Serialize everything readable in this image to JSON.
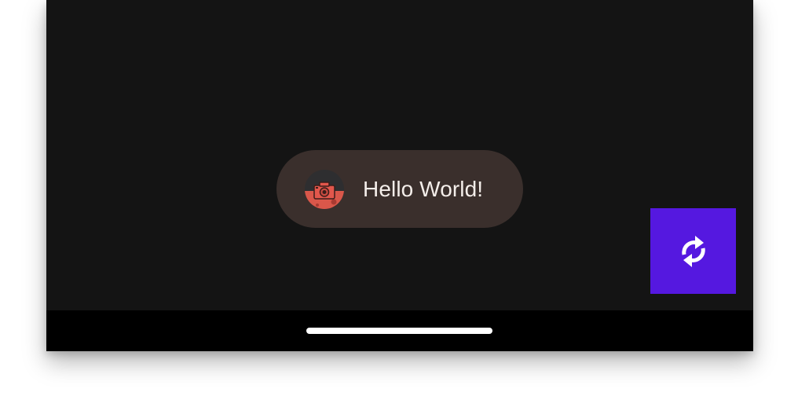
{
  "toast": {
    "message": "Hello World!",
    "icon": "camera-avatar-icon"
  },
  "fab": {
    "icon": "sync-icon",
    "color": "#5518e0"
  },
  "nav_bar": {
    "home_indicator": "home-indicator"
  },
  "colors": {
    "background": "#141414",
    "toast_background": "#3a2f2c",
    "toast_text": "#f4eeea",
    "fab": "#5518e0"
  }
}
